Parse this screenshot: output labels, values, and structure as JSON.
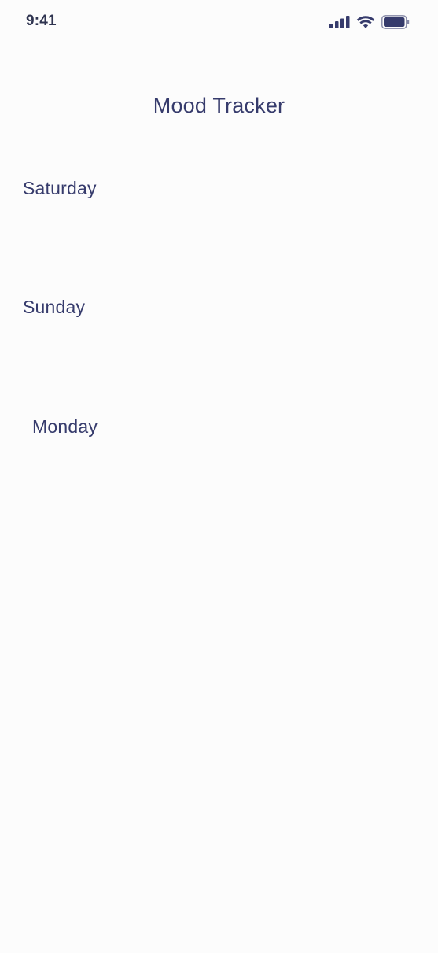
{
  "status_bar": {
    "time": "9:41",
    "icons": [
      "signal-icon",
      "wifi-icon",
      "battery-icon"
    ],
    "icon_color": "#363b6c"
  },
  "header": {
    "title": "Mood Tracker"
  },
  "days": [
    {
      "label": "Saturday"
    },
    {
      "label": "Sunday"
    },
    {
      "label": "Monday"
    }
  ],
  "colors": {
    "background": "#fcfcfc",
    "text": "#363b6c"
  }
}
